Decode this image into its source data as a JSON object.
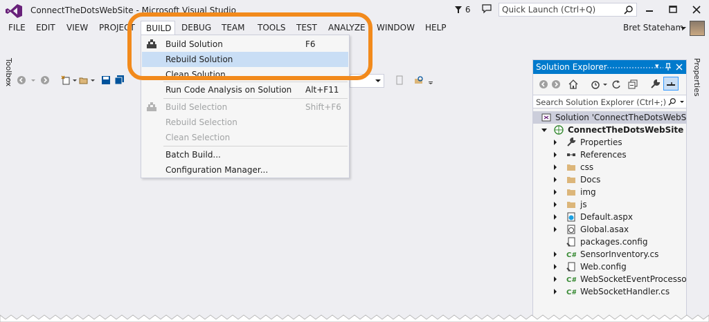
{
  "window": {
    "title": "ConnectTheDotsWebSite - Microsoft Visual Studio",
    "notification_count": "6",
    "quick_launch_placeholder": "Quick Launch (Ctrl+Q)"
  },
  "menubar": {
    "items": [
      "FILE",
      "EDIT",
      "VIEW",
      "PROJECT",
      "BUILD",
      "DEBUG",
      "TEAM",
      "TOOLS",
      "TEST",
      "ANALYZE",
      "WINDOW",
      "HELP"
    ],
    "open_menu": "BUILD",
    "user_name": "Bret Stateham"
  },
  "side_tabs": {
    "left": "Toolbox",
    "right": "Properties"
  },
  "build_menu": {
    "items": [
      {
        "label": "Build Solution",
        "shortcut": "F6",
        "enabled": true,
        "icon": "build-icon"
      },
      {
        "label": "Rebuild Solution",
        "shortcut": "",
        "enabled": true,
        "hover": true
      },
      {
        "label": "Clean Solution",
        "shortcut": "",
        "enabled": true
      },
      {
        "label": "Run Code Analysis on Solution",
        "shortcut": "Alt+F11",
        "enabled": true
      },
      {
        "label": "Build Selection",
        "shortcut": "Shift+F6",
        "enabled": false,
        "icon": "build-icon"
      },
      {
        "label": "Rebuild Selection",
        "shortcut": "",
        "enabled": false
      },
      {
        "label": "Clean Selection",
        "shortcut": "",
        "enabled": false
      },
      {
        "label": "Batch Build...",
        "shortcut": "",
        "enabled": true
      },
      {
        "label": "Configuration Manager...",
        "shortcut": "",
        "enabled": true
      }
    ]
  },
  "solution_explorer": {
    "title": "Solution Explorer",
    "search_placeholder": "Search Solution Explorer (Ctrl+;)",
    "solution_label": "Solution 'ConnectTheDotsWebSite' (",
    "project_label": "ConnectTheDotsWebSite",
    "items": [
      {
        "label": "Properties",
        "icon": "wrench-icon"
      },
      {
        "label": "References",
        "icon": "references-icon"
      },
      {
        "label": "css",
        "icon": "folder-icon"
      },
      {
        "label": "Docs",
        "icon": "folder-icon"
      },
      {
        "label": "img",
        "icon": "folder-icon"
      },
      {
        "label": "js",
        "icon": "folder-icon"
      },
      {
        "label": "Default.aspx",
        "icon": "web-page-icon"
      },
      {
        "label": "Global.asax",
        "icon": "global-icon"
      },
      {
        "label": "packages.config",
        "icon": "config-icon"
      },
      {
        "label": "SensorInventory.cs",
        "icon": "csharp-icon"
      },
      {
        "label": "Web.config",
        "icon": "config-icon"
      },
      {
        "label": "WebSocketEventProcessor.cs",
        "icon": "csharp-icon"
      },
      {
        "label": "WebSocketHandler.cs",
        "icon": "csharp-icon"
      }
    ]
  },
  "colors": {
    "accent": "#007ACC",
    "highlight_annotation": "#F28A1C",
    "menu_hover": "#C9DEF5",
    "background": "#EEEEF2"
  }
}
